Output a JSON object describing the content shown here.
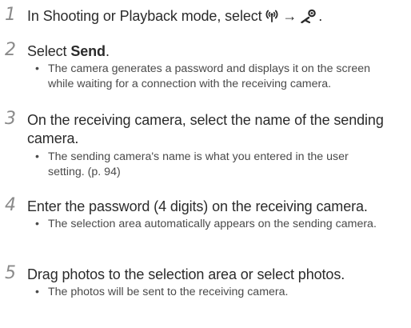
{
  "steps": [
    {
      "number": "1",
      "text_before": "In Shooting or Playback mode, select ",
      "arrow": "→",
      "text_after": ".",
      "icons": [
        "wifi-mode-icon",
        "camera-mode-icon"
      ]
    },
    {
      "number": "2",
      "text_before": "Select ",
      "bold": "Send",
      "text_after": ".",
      "bullets": [
        "The camera generates a password and displays it on the screen while waiting for a connection with the receiving camera."
      ]
    },
    {
      "number": "3",
      "text": "On the receiving camera, select the name of the sending camera.",
      "bullets": [
        "The sending camera's name is what you entered in the user setting. (p. 94)"
      ]
    },
    {
      "number": "4",
      "text": "Enter the password (4 digits) on the receiving camera.",
      "bullets": [
        "The selection area automatically appears on the sending camera."
      ]
    },
    {
      "number": "5",
      "text": "Drag photos to the selection area or select photos.",
      "bullets": [
        "The photos will be sent to the receiving camera."
      ]
    }
  ],
  "bullet_symbol": "•",
  "colors": {
    "text": "#2b2b2b",
    "bullet_text": "#4a4a4a",
    "step_number": "#8a8a8a"
  }
}
